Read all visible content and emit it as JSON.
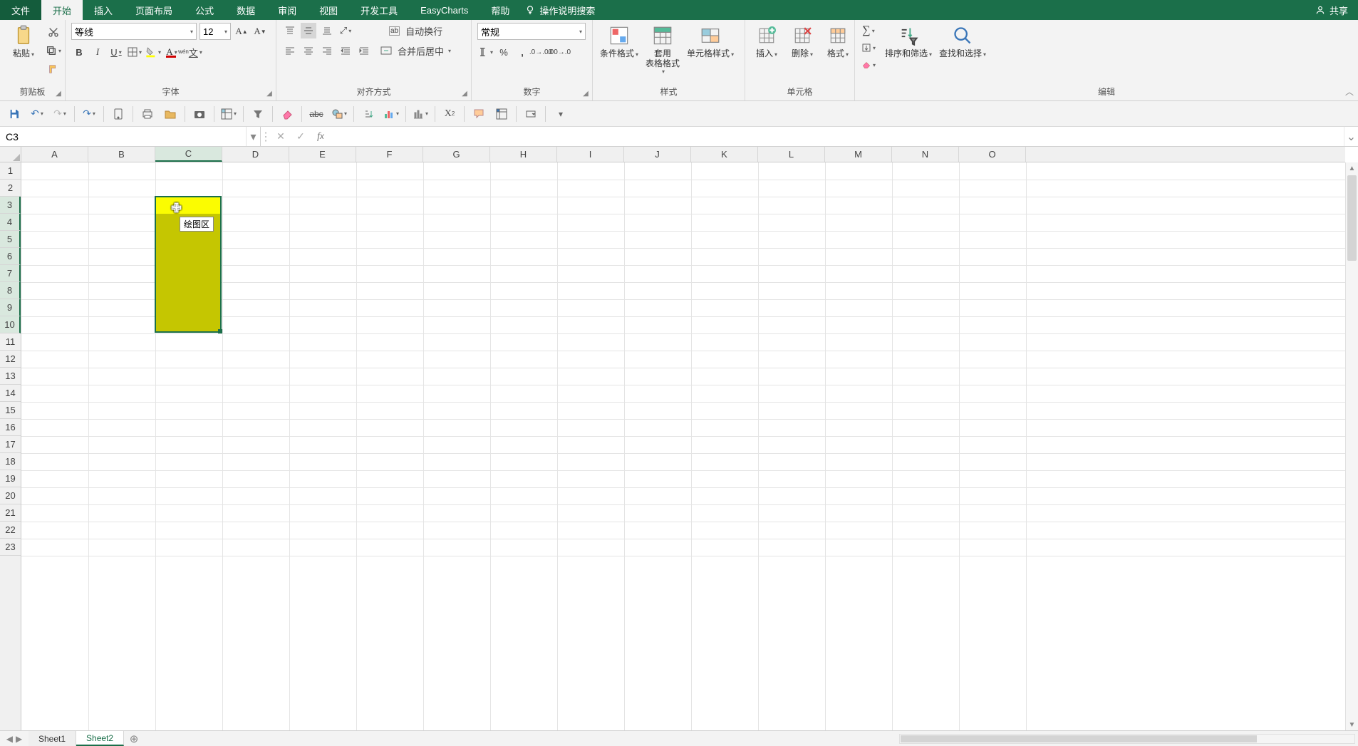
{
  "tabs": {
    "file": "文件",
    "home": "开始",
    "insert": "插入",
    "layout": "页面布局",
    "formulas": "公式",
    "data": "数据",
    "review": "审阅",
    "view": "视图",
    "dev": "开发工具",
    "easy": "EasyCharts",
    "help": "帮助",
    "tell": "操作说明搜索"
  },
  "share": "共享",
  "groups": {
    "clipboard": {
      "label": "剪贴板",
      "paste": "粘贴"
    },
    "font": {
      "label": "字体",
      "name": "等线",
      "size": "12",
      "pinyin": "wén"
    },
    "align": {
      "label": "对齐方式",
      "wrap": "自动换行",
      "merge": "合并后居中"
    },
    "number": {
      "label": "数字",
      "format": "常规"
    },
    "styles": {
      "label": "样式",
      "cond": "条件格式",
      "table": "套用\n表格格式",
      "cell": "单元格样式"
    },
    "cells": {
      "label": "单元格",
      "ins": "插入",
      "del": "删除",
      "fmt": "格式"
    },
    "edit": {
      "label": "编辑",
      "sort": "排序和筛选",
      "find": "查找和选择"
    }
  },
  "namebox": "C3",
  "tooltip": "绘图区",
  "columns": [
    "A",
    "B",
    "C",
    "D",
    "E",
    "F",
    "G",
    "H",
    "I",
    "J",
    "K",
    "L",
    "M",
    "N",
    "O"
  ],
  "rows": 23,
  "selection": {
    "colIndex": 2,
    "rowStart": 3,
    "rowEnd": 10
  },
  "highlightRow": 3,
  "sheets": {
    "s1": "Sheet1",
    "s2": "Sheet2"
  },
  "active_tab": "home",
  "active_sheet": "s2"
}
